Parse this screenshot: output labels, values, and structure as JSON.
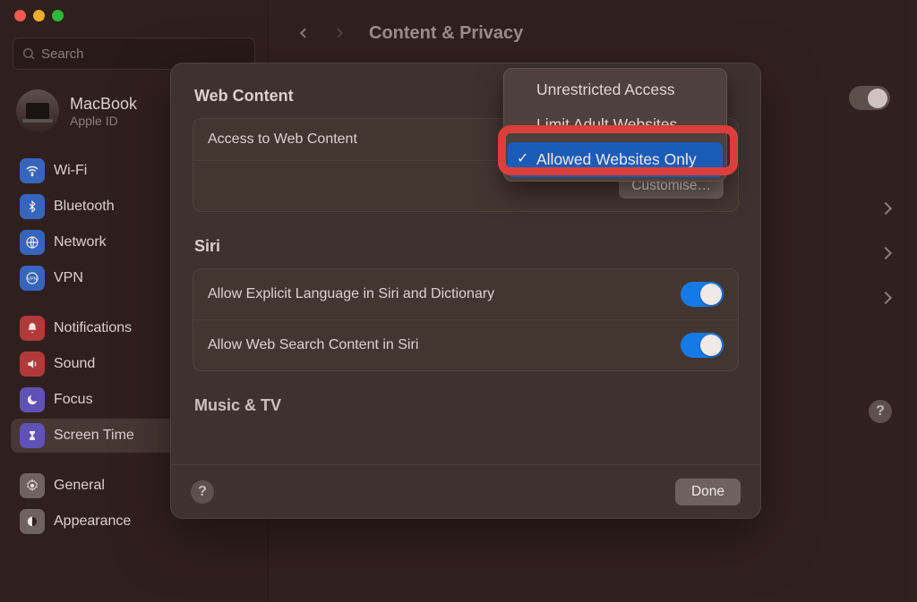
{
  "window": {
    "title": "Content & Privacy",
    "search_placeholder": "Search"
  },
  "profile": {
    "name": "MacBook",
    "sub": "Apple ID"
  },
  "sidebar": {
    "items": [
      {
        "label": "Wi-Fi",
        "icon": "wifi",
        "color": "ic-blue"
      },
      {
        "label": "Bluetooth",
        "icon": "bt",
        "color": "ic-blue"
      },
      {
        "label": "Network",
        "icon": "globe",
        "color": "ic-net"
      },
      {
        "label": "VPN",
        "icon": "vpn",
        "color": "ic-vpn"
      }
    ],
    "items2": [
      {
        "label": "Notifications",
        "icon": "bell",
        "color": "ic-red"
      },
      {
        "label": "Sound",
        "icon": "sound",
        "color": "ic-red"
      },
      {
        "label": "Focus",
        "icon": "moon",
        "color": "ic-purple"
      },
      {
        "label": "Screen Time",
        "icon": "hour",
        "color": "ic-hour",
        "active": true
      }
    ],
    "items3": [
      {
        "label": "General",
        "icon": "gear",
        "color": "ic-grey"
      },
      {
        "label": "Appearance",
        "icon": "appear",
        "color": "ic-grey"
      }
    ]
  },
  "sheet": {
    "sections": {
      "web": {
        "title": "Web Content",
        "access_label": "Access to Web Content",
        "options": [
          "Unrestricted Access",
          "Limit Adult Websites",
          "Allowed Websites Only"
        ],
        "selected_index": 2,
        "customise_label": "Customise…"
      },
      "siri": {
        "title": "Siri",
        "rows": [
          {
            "label": "Allow Explicit Language in Siri and Dictionary",
            "on": true
          },
          {
            "label": "Allow Web Search Content in Siri",
            "on": true
          }
        ]
      },
      "music": {
        "title": "Music & TV"
      }
    },
    "done_label": "Done"
  }
}
